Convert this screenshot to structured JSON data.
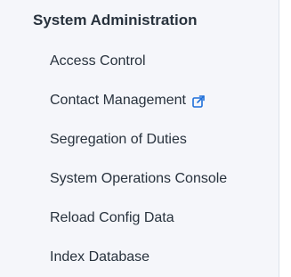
{
  "sidebar": {
    "section_title": "System Administration",
    "items": [
      {
        "label": "Access Control"
      },
      {
        "label": "Contact Management",
        "icon": "external-link-icon"
      },
      {
        "label": "Segregation of Duties"
      },
      {
        "label": "System Operations Console"
      },
      {
        "label": "Reload Config Data"
      },
      {
        "label": "Index Database"
      }
    ]
  },
  "colors": {
    "background": "#f5f6fa",
    "text": "#28323d",
    "accent": "#1e6fd9"
  }
}
